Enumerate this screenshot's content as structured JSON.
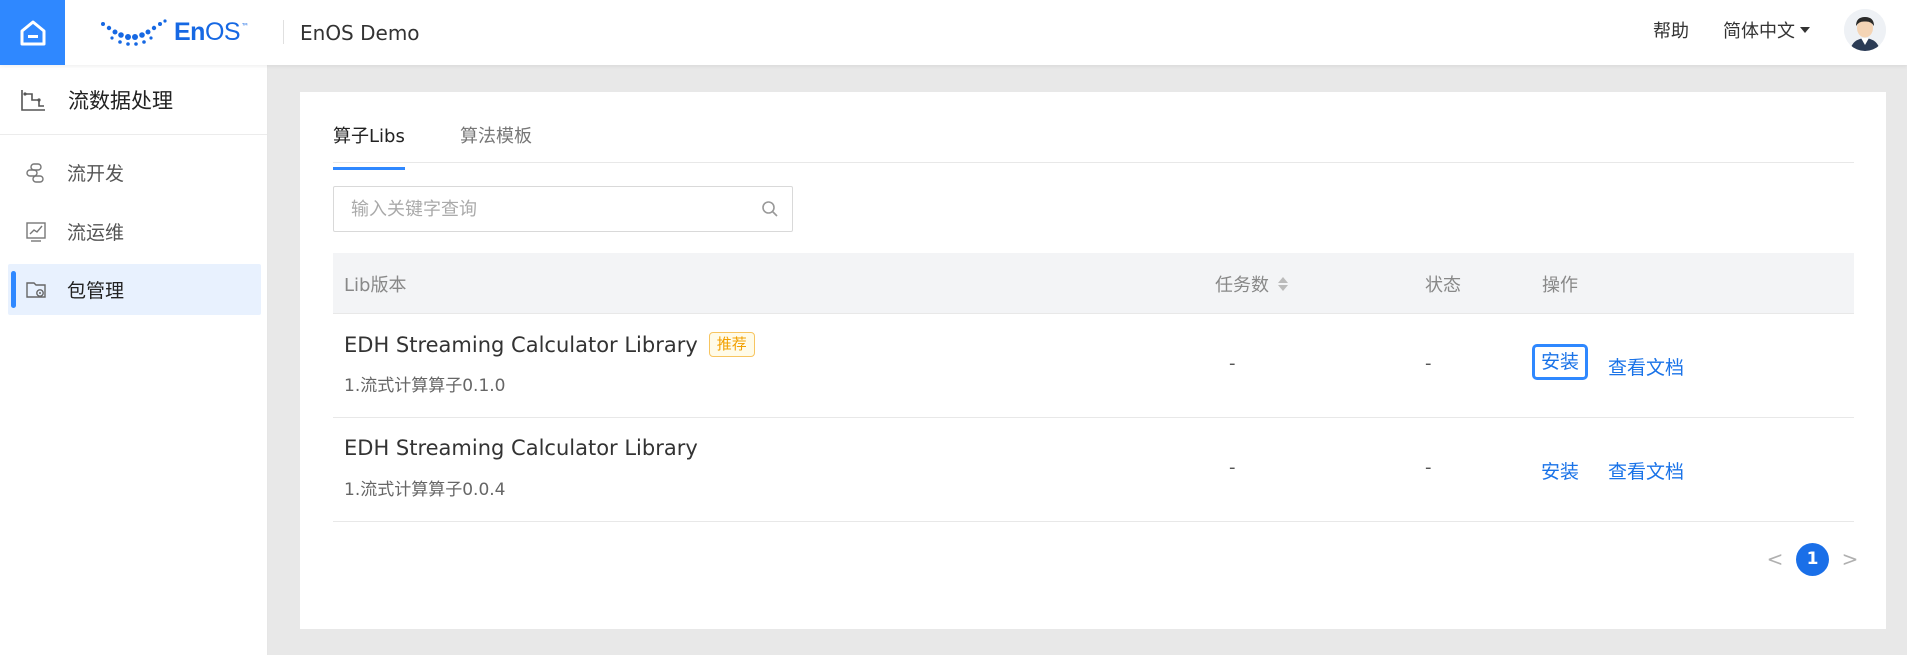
{
  "header": {
    "logo_text_en": "En",
    "logo_text_os": "OS",
    "logo_tm": "™",
    "app_title": "EnOS Demo",
    "help_label": "帮助",
    "language": "简体中文"
  },
  "sidebar": {
    "title": "流数据处理",
    "items": [
      {
        "label": "流开发",
        "icon": "stream-dev-icon"
      },
      {
        "label": "流运维",
        "icon": "stream-ops-icon"
      },
      {
        "label": "包管理",
        "icon": "package-manage-icon",
        "active": true
      }
    ]
  },
  "tabs": [
    {
      "label": "算子Libs",
      "active": true
    },
    {
      "label": "算法模板",
      "active": false
    }
  ],
  "search": {
    "placeholder": "输入关键字查询",
    "value": ""
  },
  "table": {
    "columns": [
      "Lib版本",
      "任务数",
      "状态",
      "操作"
    ],
    "rows": [
      {
        "name": "EDH Streaming Calculator Library",
        "badge": "推荐",
        "version": "1.流式计算算子0.1.0",
        "tasks": "-",
        "status": "-",
        "install": "安装",
        "docs": "查看文档"
      },
      {
        "name": "EDH Streaming Calculator Library",
        "badge": "",
        "version": "1.流式计算算子0.0.4",
        "tasks": "-",
        "status": "-",
        "install": "安装",
        "docs": "查看文档"
      }
    ]
  },
  "pagination": {
    "prev": "<",
    "current": "1",
    "next": ">"
  },
  "colors": {
    "accent": "#2f88ff",
    "link": "#1a73e8",
    "badge": "#f2a000"
  }
}
